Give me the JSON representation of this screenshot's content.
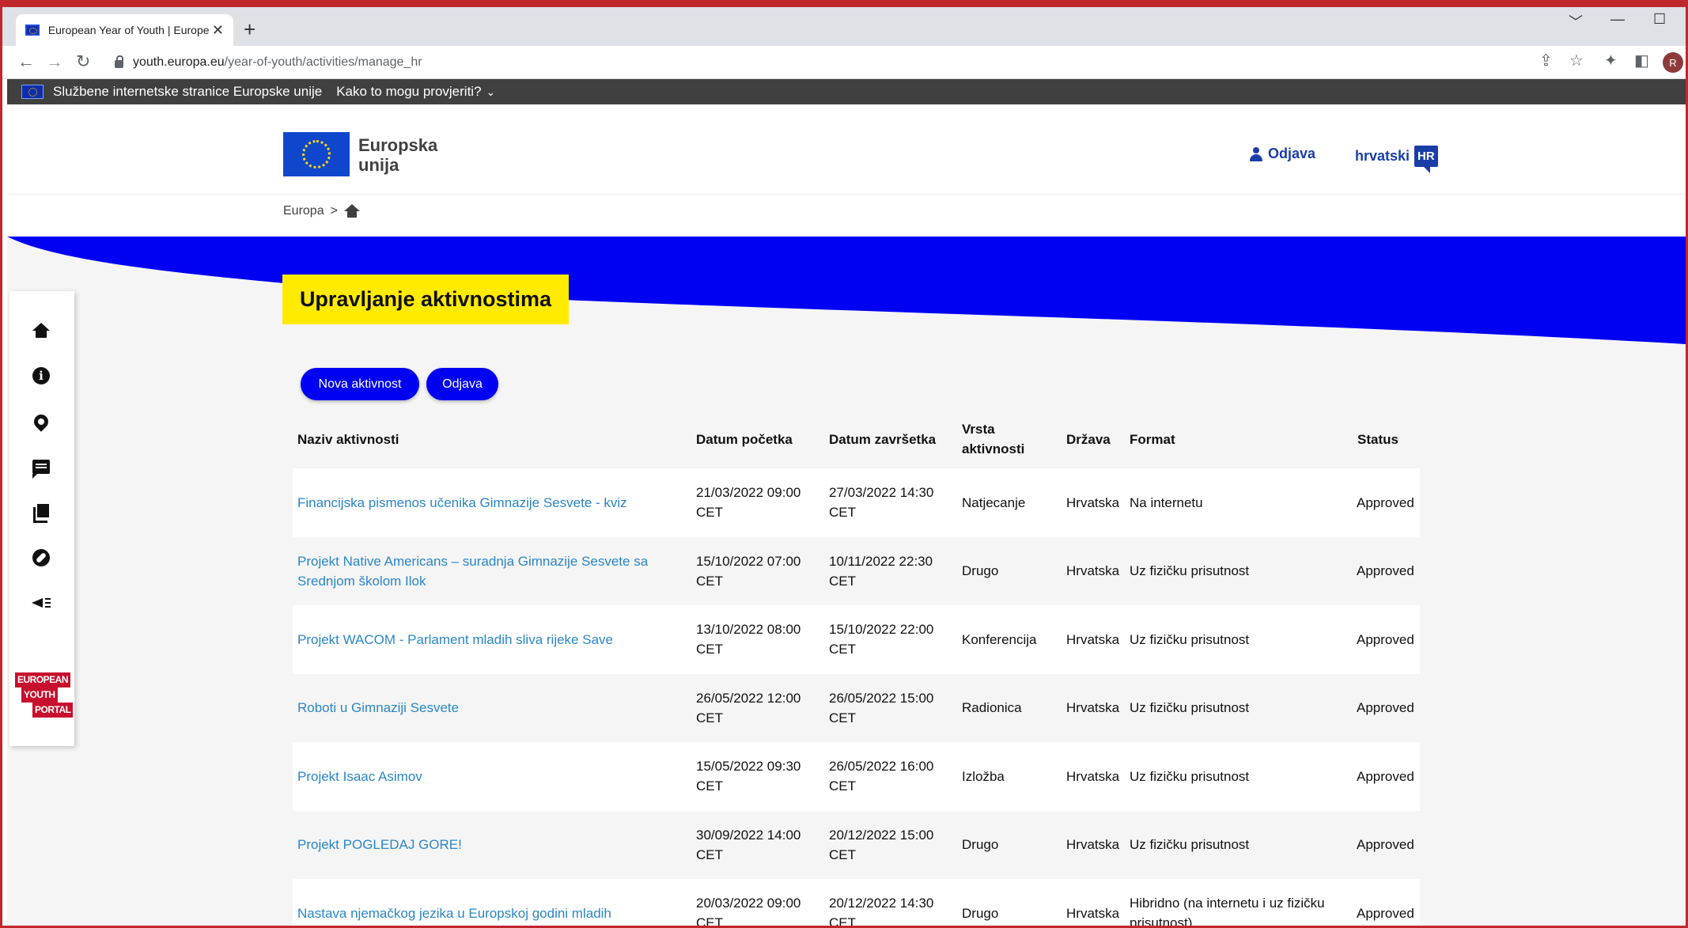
{
  "browser": {
    "tab_title": "European Year of Youth | Europe",
    "tab_close": "✕",
    "new_tab": "+",
    "url_host": "youth.europa.eu",
    "url_path": "/year-of-youth/activities/manage_hr",
    "profile_initial": "R"
  },
  "eu_banner": {
    "text": "Službene internetske stranice Europske unije",
    "how_text": "Kako to mogu provjeriti?"
  },
  "header": {
    "logo_line1": "Europska",
    "logo_line2": "unija",
    "logout": "Odjava",
    "language": "hrvatski",
    "language_code": "HR"
  },
  "breadcrumb": {
    "europa": "Europa",
    "separator": ">"
  },
  "page": {
    "title": "Upravljanje aktivnostima",
    "new_activity_button": "Nova aktivnost",
    "logout_button": "Odjava"
  },
  "sidebar": {
    "icons": [
      "home-icon",
      "info-icon",
      "map-pin-icon",
      "chat-icon",
      "library-icon",
      "compass-icon",
      "megaphone-icon"
    ],
    "portal_logo": [
      "EUROPEAN",
      "YOUTH",
      "PORTAL"
    ]
  },
  "table": {
    "headers": {
      "name": "Naziv aktivnosti",
      "start": "Datum početka",
      "end": "Datum završetka",
      "type_line1": "Vrsta",
      "type_line2": "aktivnosti",
      "country": "Država",
      "format": "Format",
      "status": "Status"
    },
    "rows": [
      {
        "name": "Financijska pismenos učenika Gimnazije Sesvete - kviz",
        "start": "21/03/2022 09:00",
        "start_tz": "CET",
        "end": "27/03/2022 14:30",
        "end_tz": "CET",
        "type": "Natjecanje",
        "country": "Hrvatska",
        "format": "Na internetu",
        "status": "Approved"
      },
      {
        "name": "Projekt Native Americans – suradnja Gimnazije Sesvete sa Srednjom školom Ilok",
        "start": "15/10/2022 07:00",
        "start_tz": "CET",
        "end": "10/11/2022 22:30",
        "end_tz": "CET",
        "type": "Drugo",
        "country": "Hrvatska",
        "format": "Uz fizičku prisutnost",
        "status": "Approved"
      },
      {
        "name": "Projekt WACOM - Parlament mladih sliva rijeke Save",
        "start": "13/10/2022 08:00",
        "start_tz": "CET",
        "end": "15/10/2022 22:00",
        "end_tz": "CET",
        "type": "Konferencija",
        "country": "Hrvatska",
        "format": "Uz fizičku prisutnost",
        "status": "Approved"
      },
      {
        "name": "Roboti u Gimnaziji Sesvete",
        "start": "26/05/2022 12:00",
        "start_tz": "CET",
        "end": "26/05/2022 15:00",
        "end_tz": "CET",
        "type": "Radionica",
        "country": "Hrvatska",
        "format": "Uz fizičku prisutnost",
        "status": "Approved"
      },
      {
        "name": "Projekt Isaac Asimov",
        "start": "15/05/2022 09:30",
        "start_tz": "CET",
        "end": "26/05/2022 16:00",
        "end_tz": "CET",
        "type": "Izložba",
        "country": "Hrvatska",
        "format": "Uz fizičku prisutnost",
        "status": "Approved"
      },
      {
        "name": "Projekt POGLEDAJ GORE!",
        "start": "30/09/2022 14:00",
        "start_tz": "CET",
        "end": "20/12/2022 15:00",
        "end_tz": "CET",
        "type": "Drugo",
        "country": "Hrvatska",
        "format": "Uz fizičku prisutnost",
        "status": "Approved"
      },
      {
        "name": "Nastava njemačkog jezika u Europskoj godini mladih",
        "start": "20/03/2022 09:00",
        "start_tz": "CET",
        "end": "20/12/2022 14:30",
        "end_tz": "CET",
        "type": "Drugo",
        "country": "Hrvatska",
        "format": "Hibridno (na internetu i uz fizičku prisutnost)",
        "status": "Approved"
      }
    ]
  },
  "colors": {
    "eu_blue": "#0000f3",
    "title_yellow": "#ffeb00",
    "link_blue": "#2a86c8",
    "frame_red": "#c0282d"
  }
}
